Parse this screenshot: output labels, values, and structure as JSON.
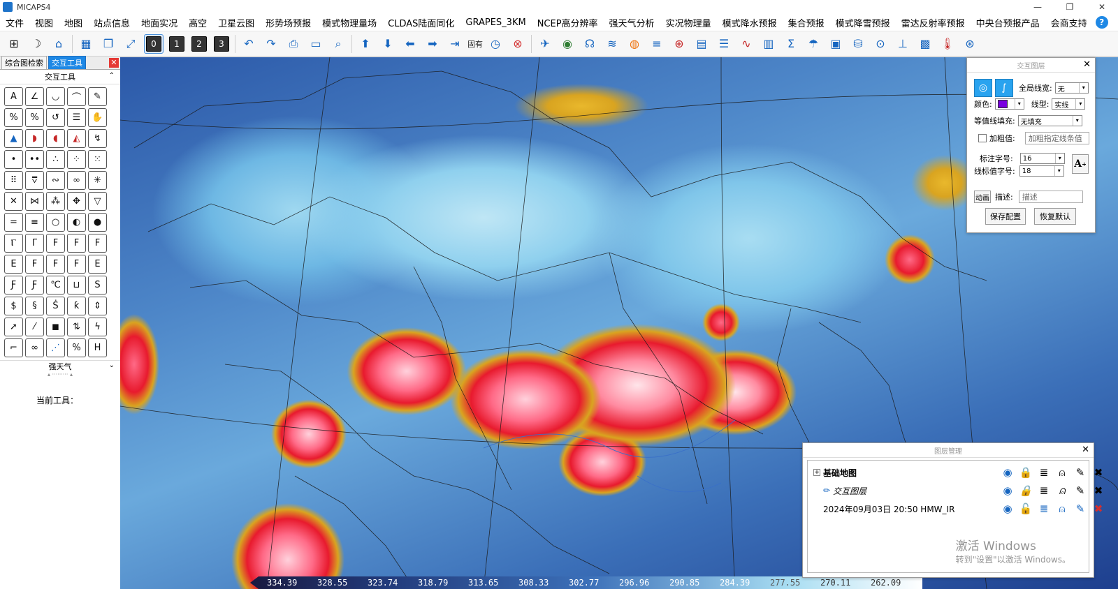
{
  "window": {
    "title": "MICAPS4"
  },
  "menu": [
    "文件",
    "视图",
    "地图",
    "站点信息",
    "地面实况",
    "高空",
    "卫星云图",
    "形势场预报",
    "模式物理量场",
    "CLDAS陆面同化",
    "GRAPES_3KM",
    "NCEP高分辨率",
    "强天气分析",
    "实况物理量",
    "模式降水预报",
    "集合预报",
    "模式降雪预报",
    "雷达反射率预报",
    "中央台预报产品",
    "会商支持"
  ],
  "toolbar": {
    "fixed_label": "固有",
    "time_level_buttons": [
      "0",
      "1",
      "2",
      "3"
    ]
  },
  "left_panel": {
    "tabs": [
      "综合图检索",
      "交互工具"
    ],
    "section_title": "交互工具",
    "strong_weather_label": "强天气",
    "current_tool_label": "当前工具："
  },
  "colorbar": {
    "ticks": [
      "334.39",
      "328.55",
      "323.74",
      "318.79",
      "313.65",
      "308.33",
      "302.77",
      "296.96",
      "290.85",
      "284.39",
      "277.55",
      "270.11",
      "262.09"
    ]
  },
  "interactive_layer_panel": {
    "title": "交互图层",
    "global_linewidth_label": "全局线宽:",
    "global_linewidth_value": "无",
    "color_label": "颜色:",
    "color_value": "#7a00e0",
    "linetype_label": "线型:",
    "linetype_value": "实线",
    "contour_fill_label": "等值线填充:",
    "contour_fill_value": "无填充",
    "bold_label": "加粗值:",
    "bold_placeholder": "加粗指定线条值",
    "label_font_label": "标注字号:",
    "label_font_value": "16",
    "line_label_font_label": "线标值字号:",
    "line_label_font_value": "18",
    "animation_button": "动画",
    "desc_label": "描述:",
    "desc_placeholder": "描述",
    "save_button": "保存配置",
    "restore_button": "恢复默认"
  },
  "layer_manager": {
    "title": "图层管理",
    "layers": [
      {
        "name": "基础地图"
      },
      {
        "name": "交互图层"
      },
      {
        "name": "2024年09月03日 20:50 HMW_IR"
      }
    ]
  },
  "watermark": {
    "line1": "激活 Windows",
    "line2": "转到\"设置\"以激活 Windows。"
  }
}
